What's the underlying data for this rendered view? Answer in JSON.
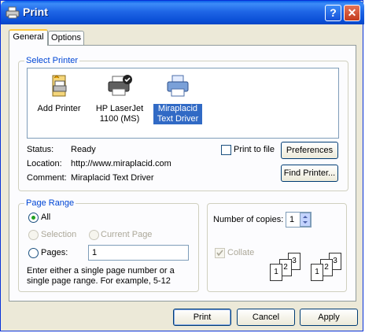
{
  "window": {
    "title": "Print",
    "help_label": "?",
    "close_label": "✕"
  },
  "tabs": [
    {
      "label": "General"
    },
    {
      "label": "Options"
    }
  ],
  "select_printer": {
    "legend": "Select Printer",
    "printers": [
      {
        "label": "Add Printer",
        "icon": "add-printer-icon"
      },
      {
        "label": "HP LaserJet\n1100 (MS)",
        "icon": "laser-printer-icon"
      },
      {
        "label": "Miraplacid\nText Driver",
        "icon": "printer-icon"
      }
    ],
    "status_label": "Status:",
    "status_value": "Ready",
    "location_label": "Location:",
    "location_value": "http://www.miraplacid.com",
    "comment_label": "Comment:",
    "comment_value": "Miraplacid Text Driver",
    "print_to_file_label": "Print to file",
    "preferences_label": "Preferences",
    "find_printer_label": "Find Printer..."
  },
  "page_range": {
    "legend": "Page Range",
    "all_label": "All",
    "selection_label": "Selection",
    "current_page_label": "Current Page",
    "pages_label": "Pages:",
    "pages_value": "1",
    "help_text": "Enter either a single page number or a single page range.  For example, 5-12"
  },
  "copies": {
    "number_label": "Number of copies:",
    "number_value": "1",
    "collate_label": "Collate",
    "collate_digits": [
      "1",
      "2",
      "3"
    ]
  },
  "footer": {
    "print_label": "Print",
    "cancel_label": "Cancel",
    "apply_label": "Apply"
  },
  "colors": {
    "accent": "#0046d5",
    "title_bar": "#0a4fd6",
    "selection": "#316ac5"
  }
}
